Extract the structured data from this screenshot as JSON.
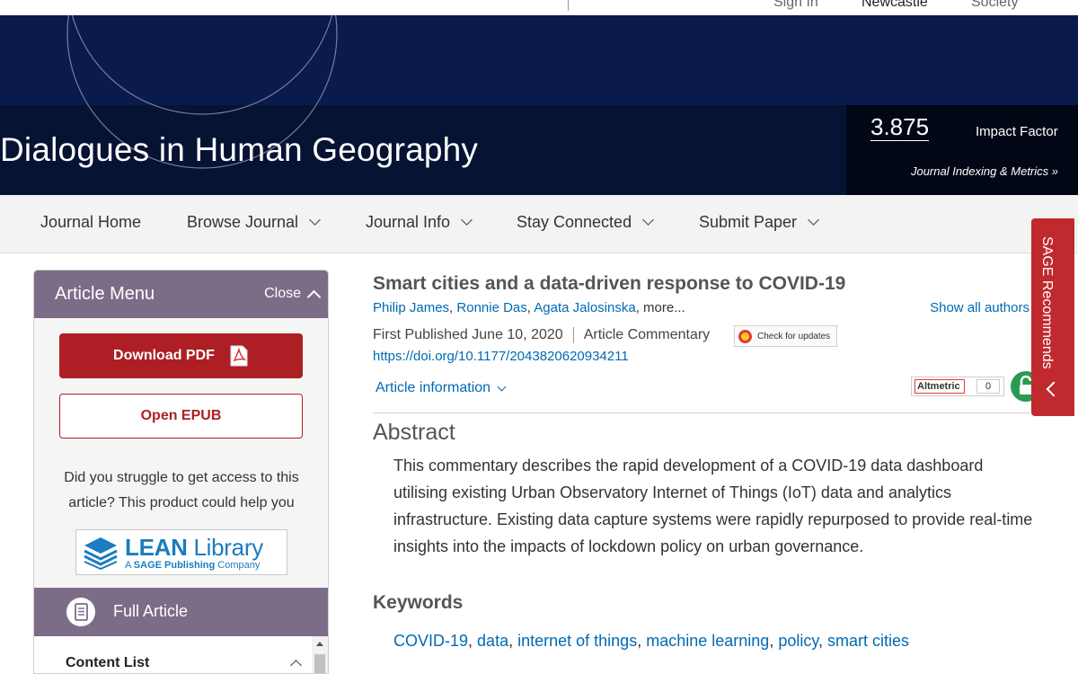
{
  "topbar": {
    "links": [
      "Sign In",
      "Newcastle",
      "Society"
    ]
  },
  "banner": {
    "journal_title": "Dialogues in Human Geography",
    "impact_value": "3.875",
    "impact_label": "Impact Factor",
    "metrics_link": "Journal Indexing & Metrics »"
  },
  "nav": {
    "items": [
      {
        "label": "Journal Home",
        "dropdown": false
      },
      {
        "label": "Browse Journal",
        "dropdown": true
      },
      {
        "label": "Journal Info",
        "dropdown": true
      },
      {
        "label": "Stay Connected",
        "dropdown": true
      },
      {
        "label": "Submit Paper",
        "dropdown": true
      }
    ]
  },
  "sidebar": {
    "title": "Article Menu",
    "close_label": "Close",
    "download_pdf": "Download PDF",
    "open_epub": "Open EPUB",
    "access_text": "Did you struggle to get access to this article? This product could help you",
    "lean_title_bold": "LEAN",
    "lean_title_rest": "Library",
    "lean_sub_prefix": "A ",
    "lean_sub_brand": "SAGE Publishing",
    "lean_sub_suffix": " Company",
    "full_article": "Full Article",
    "content_list": "Content List"
  },
  "article": {
    "title": "Smart cities and a data-driven response to COVID-19",
    "authors": [
      "Philip James",
      "Ronnie Das",
      "Agata Jalosinska"
    ],
    "more": "more...",
    "show_all_authors": "Show all authors",
    "first_published": "First Published June 10, 2020",
    "article_type": "Article Commentary",
    "check_updates": "Check for updates",
    "doi": "https://doi.org/10.1177/2043820620934211",
    "article_info": "Article information",
    "altmetric_label": "Altmetric",
    "altmetric_count": "0",
    "abstract_heading": "Abstract",
    "abstract_text": "This commentary describes the rapid development of a COVID-19 data dashboard utilising existing Urban Observatory Internet of Things (IoT) data and analytics infrastructure. Existing data capture systems were rapidly repurposed to provide real-time insights into the impacts of lockdown policy on urban governance.",
    "keywords_heading": "Keywords",
    "keywords": [
      "COVID-19",
      "data",
      "internet of things",
      "machine learning",
      "policy",
      "smart cities"
    ]
  },
  "sage_tab": {
    "label": "SAGE Recommends"
  },
  "colors": {
    "banner": "#0a1a4c",
    "menu_header": "#7b6d87",
    "accent_red": "#ad1f24",
    "link_blue": "#006ab3",
    "open_access_green": "#2b9a54"
  }
}
